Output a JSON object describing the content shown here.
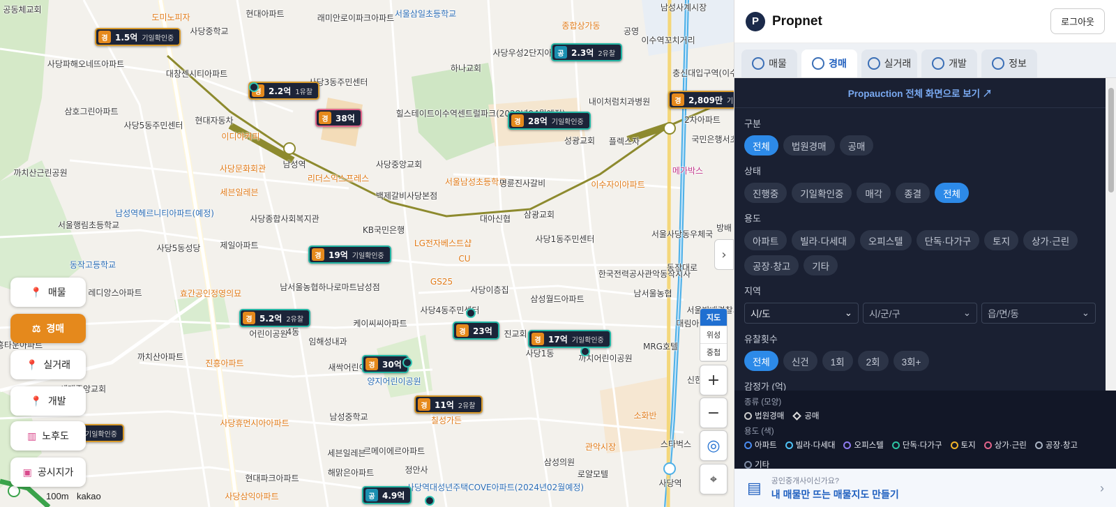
{
  "map": {
    "scale_label": "100m",
    "provider_label": "kakao",
    "map_types": [
      "지도",
      "위성",
      "중첩"
    ],
    "zoom_in": "+",
    "zoom_out": "−",
    "collapse_icon": "chevron-right-icon",
    "labels": [
      "공동체교회",
      "도미노피자",
      "현대아파트",
      "래미안로이파크아파트",
      "서울삼일초등학교",
      "남성사계시장",
      "사당중학교",
      "종합상가동",
      "공영",
      "이수역꼬치거리",
      "사당우성2단지아파트",
      "하나교회",
      "사당파해오네뜨아파트",
      "대창센시티아파트",
      "사당3동주민센터",
      "삼호그린아파트",
      "사당5동주민센터",
      "현대자동차",
      "힐스테이트이수역센트럴파크(2028년04월예정)",
      "내이처럼치과병원",
      "성광교회",
      "플렉스자",
      "이디야커피",
      "국민은행서초동",
      "까치산근린공원",
      "사당문화회관",
      "남성역",
      "리더스익스프레스",
      "사당중앙교회",
      "서울남성초등학교",
      "명륜진사갈비",
      "이수자이아파트",
      "메가박스",
      "세븐일레븐",
      "백제갈비사당본점",
      "남성역헤르니티아파트(예정)",
      "서울행림초등학교",
      "사당종합사회복지관",
      "대아신협",
      "삼광교회",
      "방배",
      "KB국민은행",
      "사당1동주민센터",
      "서울사당동우체국",
      "제일아파트",
      "LG전자베스트샵",
      "동작고등학교",
      "CU",
      "사당5동성당",
      "GS25",
      "한국전력공사관악동작지사",
      "레디앙스아파트",
      "효간공인정영의묘",
      "남서울농협하나로마트남성점",
      "사당이층집",
      "삼성월드아파트",
      "남서울농협",
      "서울방배경찰서",
      "사당4동주민센터",
      "케이씨씨아파트",
      "진교회",
      "MRG호텔",
      "임해성내과",
      "사당1동",
      "까치어린이공원",
      "까치산아파트",
      "진흥아파트",
      "새싹어린이공원",
      "양지어린이공원",
      "신한은행",
      "남성중학교",
      "칠성가든",
      "소화반",
      "스타벅스",
      "사당휴먼시아아파트",
      "르메이에르아파트",
      "관악시장",
      "세븐일레븐",
      "해맑은아파트",
      "삼성의원",
      "로얄모텔",
      "현대파크아파트",
      "정안사",
      "사당역대성년주택COVE아파트(2024년02월예정)",
      "사당역",
      "사당삼익아파트",
      "충신대입구역(이수)",
      "2차아파트",
      "동작대로",
      "흥타운아파트",
      "세대중앙교회",
      "대림아파트",
      "어린이공원",
      "4동"
    ]
  },
  "markers": [
    {
      "tag": "경",
      "price": "1.5억",
      "status": "기일확인중",
      "kind": "auction"
    },
    {
      "tag": "경",
      "price": "2.2억",
      "status": "1유찰",
      "kind": "auction"
    },
    {
      "tag": "공",
      "price": "2.3억",
      "status": "2유찰",
      "kind": "public"
    },
    {
      "tag": "경",
      "price": "2,809만",
      "status": "기",
      "kind": "auction"
    },
    {
      "tag": "경",
      "price": "38억",
      "status": "",
      "kind": "auction"
    },
    {
      "tag": "경",
      "price": "28억",
      "status": "기일확인중",
      "kind": "auction"
    },
    {
      "tag": "경",
      "price": "19억",
      "status": "기일확인중",
      "kind": "auction"
    },
    {
      "tag": "경",
      "price": "5.2억",
      "status": "2유찰",
      "kind": "auction"
    },
    {
      "tag": "경",
      "price": "23억",
      "status": "",
      "kind": "auction"
    },
    {
      "tag": "경",
      "price": "17억",
      "status": "기일확인중",
      "kind": "auction"
    },
    {
      "tag": "경",
      "price": "30억",
      "status": "",
      "kind": "auction"
    },
    {
      "tag": "경",
      "price": "11억",
      "status": "2유찰",
      "kind": "auction"
    },
    {
      "tag": "공",
      "price": "4.9억",
      "status": "",
      "kind": "public"
    },
    {
      "tag": "",
      "price": "",
      "status": "기일확인중",
      "kind": "auction"
    }
  ],
  "left_nav": [
    {
      "label": "매물",
      "icon": "pin-icon",
      "active": false
    },
    {
      "label": "경매",
      "icon": "gavel-pin-icon",
      "active": true
    },
    {
      "label": "실거래",
      "icon": "pin-icon",
      "active": false
    },
    {
      "label": "개발",
      "icon": "pin-icon",
      "active": false
    },
    {
      "label": "노후도",
      "icon": "building-icon",
      "active": false
    },
    {
      "label": "공시지가",
      "icon": "money-icon",
      "active": false
    }
  ],
  "panel": {
    "brand": "Propnet",
    "logout": "로그아웃",
    "tabs": [
      "매물",
      "경매",
      "실거래",
      "개발",
      "정보"
    ],
    "active_tab": "경매",
    "banner": "Propauction 전체 화면으로 보기 ↗",
    "filters": {
      "kind_title": "구분",
      "kind_options": [
        "전체",
        "법원경매",
        "공매"
      ],
      "status_title": "상태",
      "status_options": [
        "진행중",
        "기일확인중",
        "매각",
        "종결",
        "전체"
      ],
      "use_title": "용도",
      "use_options": [
        "아파트",
        "빌라·다세대",
        "오피스텔",
        "단독·다가구",
        "토지",
        "상가·근린",
        "공장·창고",
        "기타"
      ],
      "region_title": "지역",
      "region_selects": [
        "시/도",
        "시/군/구",
        "읍/면/동"
      ],
      "fail_title": "유찰횟수",
      "fail_options": [
        "전체",
        "신건",
        "1회",
        "2회",
        "3회+"
      ],
      "appraisal_title": "감정가 (억)",
      "min_placeholder": "최소",
      "max_placeholder": "최대",
      "range_sep": "~"
    },
    "legend": {
      "type_title": "종류 (모양)",
      "types": [
        "법원경매",
        "공매"
      ],
      "color_title": "용도 (색)",
      "colors": [
        {
          "label": "아파트",
          "color": "#4a8bf0"
        },
        {
          "label": "빌라·다세대",
          "color": "#4fc3f7"
        },
        {
          "label": "오피스텔",
          "color": "#8e7cf0"
        },
        {
          "label": "단독·다가구",
          "color": "#2ec4a3"
        },
        {
          "label": "토지",
          "color": "#f0b429"
        },
        {
          "label": "상가·근린",
          "color": "#e2658b"
        },
        {
          "label": "공장·창고",
          "color": "#aab4c4"
        },
        {
          "label": "기타",
          "color": "#7d8aa3"
        }
      ]
    },
    "cta": {
      "question": "공인중개사이신가요?",
      "action": "내 매물만 뜨는 매물지도 만들기",
      "arrow": "›"
    },
    "accent": "#2d8ae8",
    "dark_bg": "#1a2032"
  }
}
